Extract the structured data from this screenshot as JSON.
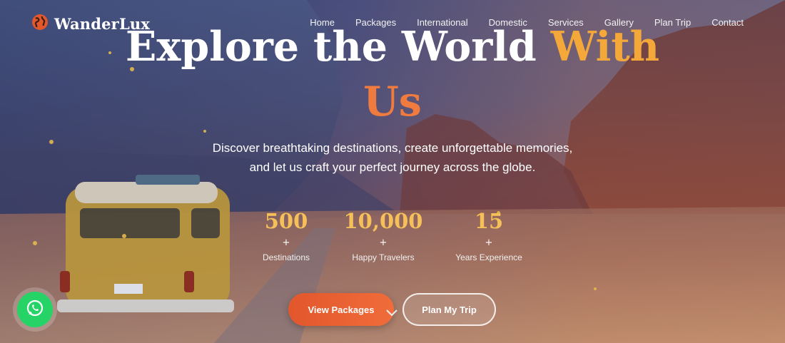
{
  "brand": {
    "name": "WanderLux",
    "logo_icon": "globe-icon",
    "accent": "#e2572c"
  },
  "nav": {
    "items": [
      "Home",
      "Packages",
      "International",
      "Domestic",
      "Services",
      "Gallery",
      "Plan Trip",
      "Contact"
    ]
  },
  "hero": {
    "headline_part1": "Explore the World",
    "headline_accent": "With",
    "headline_part2": "Us",
    "subtitle_line1": "Discover breathtaking destinations, create unforgettable memories,",
    "subtitle_line2": "and let us craft your perfect journey across the globe."
  },
  "stats": [
    {
      "value": "500",
      "plus": "+",
      "label": "Destinations"
    },
    {
      "value": "10,000",
      "plus": "+",
      "label": "Happy Travelers"
    },
    {
      "value": "15",
      "plus": "+",
      "label": "Years Experience"
    }
  ],
  "buttons": {
    "primary": "View Packages",
    "secondary": "Plan My Trip"
  },
  "icons": {
    "scroll": "chevron-down-icon",
    "chat": "whatsapp-icon"
  },
  "colors": {
    "stat_value": "#f5c05a",
    "headline_accent": "#f5a83a",
    "headline_us": "#f07b3f",
    "whatsapp": "#25d366"
  }
}
